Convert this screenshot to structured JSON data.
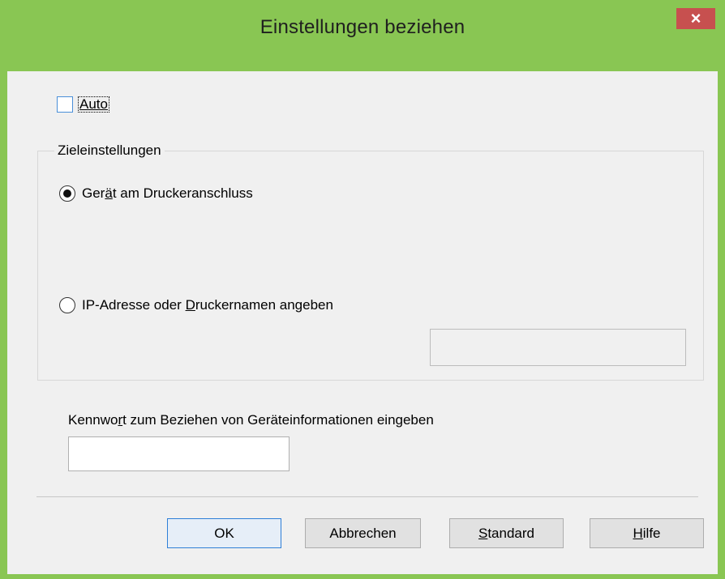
{
  "window": {
    "title": "Einstellungen beziehen",
    "close_glyph": "×"
  },
  "auto": {
    "label": "Auto",
    "checked": false
  },
  "target_settings": {
    "group_title": "Zieleinstellungen",
    "options": [
      {
        "label_prefix": "Ger",
        "label_underlined": "ä",
        "label_suffix": "t am Druckeranschluss",
        "selected": true
      },
      {
        "label_prefix": "IP-Adresse oder ",
        "label_underlined": "D",
        "label_suffix": "ruckernamen angeben",
        "selected": false
      }
    ],
    "ip_value": ""
  },
  "password": {
    "label_prefix": "Kennwo",
    "label_underlined": "r",
    "label_suffix": "t zum Beziehen von Geräteinformationen eingeben",
    "value": ""
  },
  "buttons": {
    "ok": "OK",
    "cancel": "Abbrechen",
    "standard_underlined": "S",
    "standard_rest": "tandard",
    "help_underlined": "H",
    "help_rest": "ilfe"
  },
  "colors": {
    "frame": "#89c653",
    "close": "#c7504f",
    "default_button_border": "#2f7fd7"
  }
}
